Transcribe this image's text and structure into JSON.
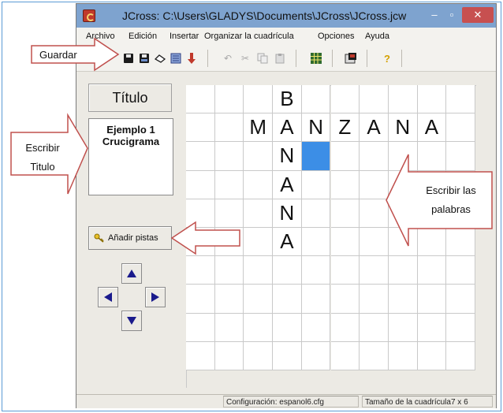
{
  "window": {
    "title": "JCross: C:\\Users\\GLADYS\\Documents\\JCross\\JCross.jcw",
    "minimize": "–",
    "maximize": "▫",
    "close": "✕"
  },
  "menubar": {
    "items": [
      "Archivo",
      "Edición",
      "Insertar",
      "Organizar la cuadrícula",
      "Opciones",
      "Ayuda"
    ]
  },
  "toolbar": {
    "icons": [
      "save-icon",
      "save-as-icon",
      "eraser-icon",
      "export-icon",
      "down-arrow-icon",
      "undo-icon",
      "cut-icon",
      "copy-icon",
      "paste-icon",
      "grid-icon",
      "html-icon",
      "help-icon"
    ],
    "help_label": "?"
  },
  "left_panel": {
    "title_button": "Título",
    "title_line1": "Ejemplo 1",
    "title_line2": "Crucigrama",
    "add_clues_button": "Añadir pistas"
  },
  "grid": {
    "columns": 10,
    "rows": 10,
    "letters": {
      "0,3": "B",
      "1,2": "M",
      "1,3": "A",
      "1,4": "N",
      "1,5": "Z",
      "1,6": "A",
      "1,7": "N",
      "1,8": "A",
      "2,3": "N",
      "3,3": "A",
      "4,3": "N",
      "5,3": "A"
    },
    "selected_cell": "2,4",
    "selected_color": "#3c8ee6"
  },
  "status": {
    "config": "Configuración: espanol6.cfg",
    "grid_size": "Tamaño de la cuadrícula7 x 6"
  },
  "callouts": {
    "guardar": "Guardar",
    "escribir_titulo_line1": "Escribir",
    "escribir_titulo_line2": "Titulo",
    "escribir_palabras_line1": "Escribir las",
    "escribir_palabras_line2": "palabras"
  },
  "colors": {
    "callout_border": "#c0504d",
    "titlebar": "#7ea3cf",
    "close_button": "#c75050"
  }
}
